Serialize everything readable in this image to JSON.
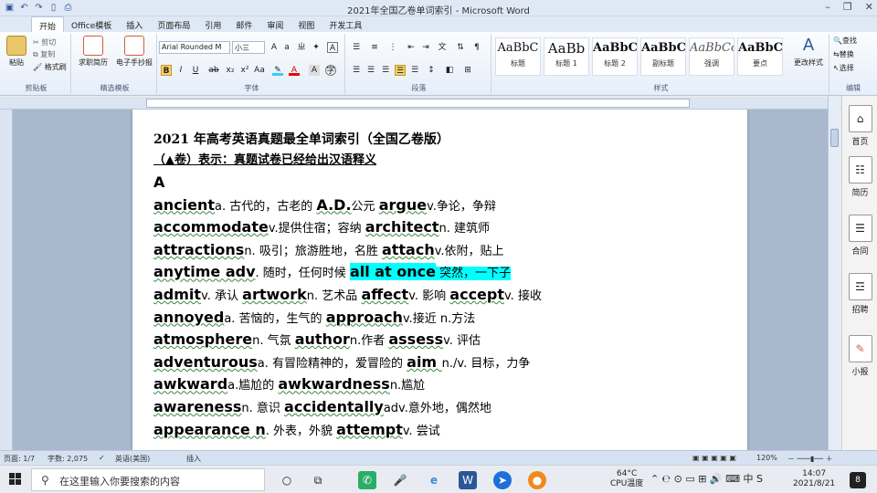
{
  "window": {
    "title": "2021年全国乙卷单词索引 - Microsoft Word"
  },
  "tabs": [
    "开始",
    "Office模板",
    "插入",
    "页面布局",
    "引用",
    "邮件",
    "审阅",
    "视图",
    "开发工具"
  ],
  "ribbon": {
    "clipboard": {
      "label": "剪贴板",
      "paste": "粘贴",
      "cut": "剪切",
      "copy": "复制",
      "format_painter": "格式刷"
    },
    "templates": {
      "label": "精选模板",
      "resume": "求职简历",
      "handout": "电子手抄报"
    },
    "font": {
      "label": "字体",
      "name": "Arial Rounded M",
      "size": "小三"
    },
    "paragraph": {
      "label": "段落"
    },
    "styles": {
      "label": "样式",
      "items": [
        {
          "preview": "AaBbC",
          "name": "标题"
        },
        {
          "preview": "AaBb",
          "name": "标题 1"
        },
        {
          "preview": "AaBbC",
          "name": "标题 2"
        },
        {
          "preview": "AaBbC",
          "name": "副标题"
        },
        {
          "preview": "AaBbCc",
          "name": "强调"
        },
        {
          "preview": "AaBbC",
          "name": "要点"
        }
      ],
      "change_styles": "更改样式"
    },
    "editing": {
      "label": "编辑",
      "find": "查找",
      "replace": "替换",
      "select": "选择"
    }
  },
  "document": {
    "title": "2021 年高考英语真题最全单词索引（全国乙卷版）",
    "note": "（▲卷）表示：真题试卷已经给出汉语释义",
    "section": "A",
    "lines": [
      [
        {
          "en": "ancient"
        },
        {
          "zh": "a. 古代的，古老的    "
        },
        {
          "en": "A.D."
        },
        {
          "zh": "公元   "
        },
        {
          "en": "argue"
        },
        {
          "zh": "v.争论，争辩"
        }
      ],
      [
        {
          "en": "accommodate"
        },
        {
          "zh": "v.提供住宿；容纳 "
        },
        {
          "en": "architect"
        },
        {
          "zh": "n. 建筑师"
        }
      ],
      [
        {
          "en": "attractions"
        },
        {
          "zh": "n. 吸引；旅游胜地，名胜    "
        },
        {
          "en": "attach"
        },
        {
          "zh": "v.依附，贴上"
        }
      ],
      [
        {
          "en": "anytime  adv"
        },
        {
          "zh": ". 随时，任何时候    "
        },
        {
          "hl": "all at once"
        },
        {
          "hlzh": " 突然，一下子"
        }
      ],
      [
        {
          "en": "admit"
        },
        {
          "zh": "v. 承认 "
        },
        {
          "en": "artwork"
        },
        {
          "zh": "n. 艺术品 "
        },
        {
          "en": "affect"
        },
        {
          "zh": "v. 影响 "
        },
        {
          "en": "accept"
        },
        {
          "zh": "v. 接收"
        }
      ],
      [
        {
          "en": "annoyed"
        },
        {
          "zh": "a. 苦恼的，生气的 "
        },
        {
          "en": "approach"
        },
        {
          "zh": "v.接近 n.方法"
        }
      ],
      [
        {
          "en": "atmosphere"
        },
        {
          "zh": "n. 气氛 "
        },
        {
          "en": "author"
        },
        {
          "zh": "n.作者 "
        },
        {
          "en": "assess"
        },
        {
          "zh": "v. 评估"
        }
      ],
      [
        {
          "en": "adventurous"
        },
        {
          "zh": "a. 有冒险精神的，爱冒险的 "
        },
        {
          "en": "aim  "
        },
        {
          "zh": "n./v. 目标，力争"
        }
      ],
      [
        {
          "en": "awkward"
        },
        {
          "zh": "a.尴尬的 "
        },
        {
          "en": "awkwardness"
        },
        {
          "zh": "n.尴尬"
        }
      ],
      [
        {
          "en": "awareness"
        },
        {
          "zh": "n. 意识 "
        },
        {
          "en": "accidentally"
        },
        {
          "zh": "adv.意外地，偶然地"
        }
      ],
      [
        {
          "en": "appearance  n"
        },
        {
          "zh": ". 外表，外貌 "
        },
        {
          "en": "attempt"
        },
        {
          "zh": "v. 尝试"
        }
      ]
    ]
  },
  "sidepanel": [
    "首页",
    "简历",
    "合同",
    "招聘",
    "小报"
  ],
  "status": {
    "page": "页面: 1/7",
    "words": "字数: 2,075",
    "lang": "英语(美国)",
    "mode": "插入",
    "zoom": "120%"
  },
  "taskbar": {
    "search_placeholder": "在这里输入你要搜索的内容",
    "temp": "64°C",
    "cpu": "CPU温度",
    "time": "14:07",
    "date": "2021/8/21",
    "badge": "8"
  }
}
